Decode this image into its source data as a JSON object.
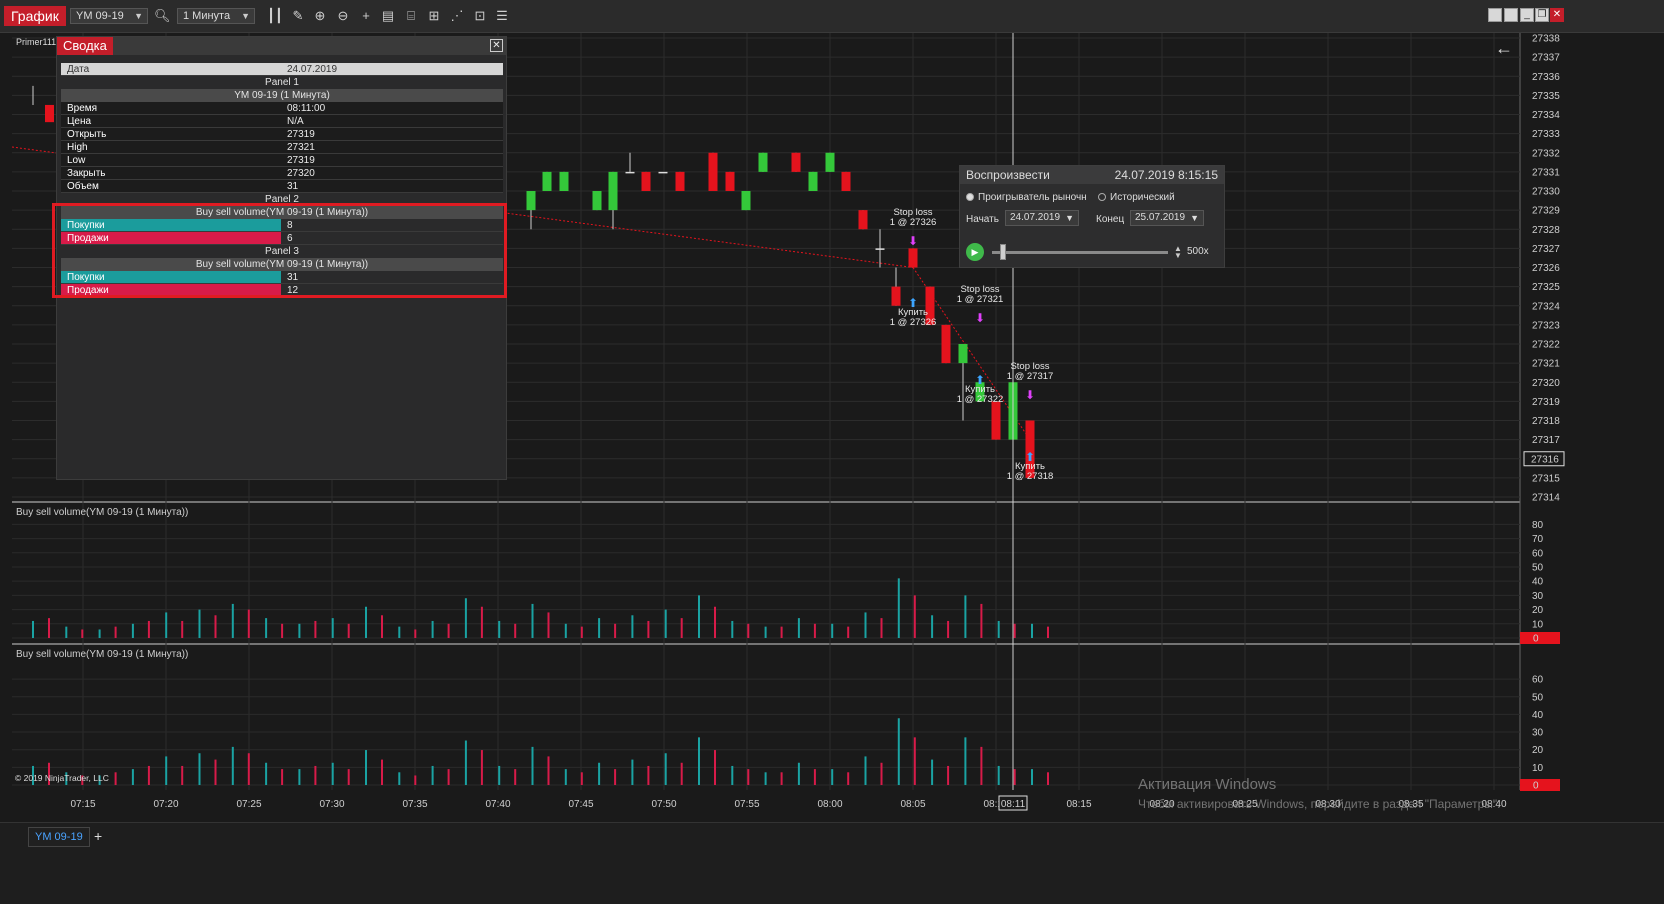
{
  "toolbar": {
    "app_title": "График",
    "instrument": "YM 09-19",
    "interval": "1 Минута"
  },
  "chart": {
    "indicator_label": "Primer111",
    "panel2_title": "Buy sell volume(YM 09-19 (1 Минута))",
    "panel3_title": "Buy sell volume(YM 09-19 (1 Минута))",
    "price_ticks": [
      "27338",
      "27337",
      "27336",
      "27335",
      "27334",
      "27333",
      "27332",
      "27331",
      "27330",
      "27329",
      "27328",
      "27327",
      "27326",
      "27325",
      "27324",
      "27323",
      "27322",
      "27321",
      "27320",
      "27319",
      "27318",
      "27317",
      "27316",
      "27315",
      "27314"
    ],
    "current_price": "27316",
    "panel2_ticks": [
      "80",
      "70",
      "60",
      "50",
      "40",
      "30",
      "20",
      "10",
      "0"
    ],
    "panel3_ticks": [
      "60",
      "50",
      "40",
      "30",
      "20",
      "10",
      "0"
    ],
    "time_ticks": [
      "07:15",
      "07:20",
      "07:25",
      "07:30",
      "07:35",
      "07:40",
      "07:45",
      "07:50",
      "07:55",
      "08:00",
      "08:05",
      "08:10",
      "08:15",
      "08:20",
      "08:25",
      "08:30",
      "08:35",
      "08:40"
    ],
    "crosshair_time": "08:11",
    "copyright": "© 2019 NinjaTrader, LLC",
    "markers": [
      {
        "text1": "Stop loss",
        "text2": "1 @ 27326"
      },
      {
        "text1": "Купить",
        "text2": "1 @ 27326"
      },
      {
        "text1": "Stop loss",
        "text2": "1 @ 27321"
      },
      {
        "text1": "Купить",
        "text2": "1 @ 27322"
      },
      {
        "text1": "Stop loss",
        "text2": "1 @ 27317"
      },
      {
        "text1": "Купить",
        "text2": "1 @ 27318"
      }
    ],
    "colors": {
      "up": "#34c83a",
      "down": "#e5131d",
      "buy": "#1aa3a3",
      "sell": "#d81b49"
    }
  },
  "summary": {
    "title": "Сводка",
    "date_label": "Дата",
    "date_value": "24.07.2019",
    "panel1": "Panel 1",
    "panel1_sub": "YM 09-19 (1 Минута)",
    "rows": [
      {
        "k": "Время",
        "v": "08:11:00"
      },
      {
        "k": "Цена",
        "v": "N/A"
      },
      {
        "k": "Открыть",
        "v": "27319"
      },
      {
        "k": "High",
        "v": "27321"
      },
      {
        "k": "Low",
        "v": "27319"
      },
      {
        "k": "Закрыть",
        "v": "27320"
      },
      {
        "k": "Объем",
        "v": "31"
      }
    ],
    "panel2": "Panel 2",
    "panel2_sub": "Buy sell volume(YM 09-19 (1 Минута))",
    "p2_buy_label": "Покупки",
    "p2_buy_value": "8",
    "p2_sell_label": "Продажи",
    "p2_sell_value": "6",
    "panel3": "Panel 3",
    "panel3_sub": "Buy sell volume(YM 09-19 (1 Минута))",
    "p3_buy_label": "Покупки",
    "p3_buy_value": "31",
    "p3_sell_label": "Продажи",
    "p3_sell_value": "12"
  },
  "playback": {
    "title": "Воспроизвести",
    "datetime": "24.07.2019 8:15:15",
    "radio_market": "Проигрыватель рыночн",
    "radio_hist": "Исторический",
    "start_label": "Начать",
    "start_value": "24.07.2019",
    "end_label": "Конец",
    "end_value": "25.07.2019",
    "speed": "500x"
  },
  "watermark": {
    "line1": "Активация Windows",
    "line2": "Чтобы активировать Windows, перейдите в раздел \"Параметры\"."
  },
  "bottom": {
    "tab": "YM 09-19",
    "add": "+"
  },
  "chart_data": {
    "type": "bar",
    "candles_description": "candlestick price chart with buy/sell volume bars",
    "candles": [
      {
        "t": "07:46",
        "o": 27329,
        "c": 27330,
        "h": 27330,
        "l": 27328
      },
      {
        "t": "07:47",
        "o": 27330,
        "c": 27331,
        "h": 27331,
        "l": 27330
      },
      {
        "t": "07:48",
        "o": 27330,
        "c": 27331,
        "h": 27331,
        "l": 27330
      },
      {
        "t": "07:50",
        "o": 27329,
        "c": 27330,
        "h": 27330,
        "l": 27329
      },
      {
        "t": "07:51",
        "o": 27329,
        "c": 27331,
        "h": 27331,
        "l": 27328
      },
      {
        "t": "07:53",
        "o": 27331,
        "c": 27331,
        "h": 27332,
        "l": 27331
      },
      {
        "t": "07:55",
        "o": 27331,
        "c": 27330,
        "h": 27331,
        "l": 27330
      },
      {
        "t": "07:56",
        "o": 27331,
        "c": 27331,
        "h": 27331,
        "l": 27331
      },
      {
        "t": "07:58",
        "o": 27331,
        "c": 27330,
        "h": 27331,
        "l": 27330
      },
      {
        "t": "07:59",
        "o": 27332,
        "c": 27330,
        "h": 27332,
        "l": 27330
      },
      {
        "t": "08:00",
        "o": 27331,
        "c": 27330,
        "h": 27331,
        "l": 27330
      },
      {
        "t": "08:01",
        "o": 27329,
        "c": 27330,
        "h": 27330,
        "l": 27329
      },
      {
        "t": "08:02",
        "o": 27331,
        "c": 27332,
        "h": 27332,
        "l": 27331
      },
      {
        "t": "08:03",
        "o": 27332,
        "c": 27331,
        "h": 27332,
        "l": 27331
      },
      {
        "t": "08:04",
        "o": 27330,
        "c": 27331,
        "h": 27331,
        "l": 27330
      },
      {
        "t": "08:05",
        "o": 27331,
        "c": 27332,
        "h": 27332,
        "l": 27331
      },
      {
        "t": "08:06",
        "o": 27331,
        "c": 27330,
        "h": 27331,
        "l": 27330
      },
      {
        "t": "08:08",
        "o": 27329,
        "c": 27328,
        "h": 27329,
        "l": 27328
      },
      {
        "t": "08:10",
        "o": 27327,
        "c": 27327,
        "h": 27328,
        "l": 27326
      },
      {
        "t": "08:11",
        "o": 27325,
        "c": 27324,
        "h": 27326,
        "l": 27324
      },
      {
        "t": "08:12",
        "o": 27327,
        "c": 27326,
        "h": 27327,
        "l": 27326
      },
      {
        "t": "08:13",
        "o": 27325,
        "c": 27323,
        "h": 27325,
        "l": 27323
      },
      {
        "t": "08:14",
        "o": 27323,
        "c": 27321,
        "h": 27323,
        "l": 27321
      },
      {
        "t": "08:14b",
        "o": 27321,
        "c": 27322,
        "h": 27322,
        "l": 27318
      },
      {
        "t": "08:15",
        "o": 27319,
        "c": 27320,
        "h": 27320,
        "l": 27319
      },
      {
        "t": "08:16",
        "o": 27319,
        "c": 27317,
        "h": 27319,
        "l": 27317
      },
      {
        "t": "08:16b",
        "o": 27317,
        "c": 27320,
        "h": 27320,
        "l": 27317
      },
      {
        "t": "08:17",
        "o": 27318,
        "c": 27315,
        "h": 27318,
        "l": 27315
      }
    ],
    "volume_panel2_buy": [
      12,
      8,
      6,
      10,
      18,
      20,
      24,
      14,
      10,
      14,
      22,
      8,
      12,
      28,
      12,
      24,
      10,
      14,
      16,
      20,
      30,
      12,
      8,
      14,
      10,
      18,
      42,
      16,
      30,
      12,
      10
    ],
    "volume_panel2_sell": [
      14,
      6,
      8,
      12,
      12,
      16,
      20,
      10,
      12,
      10,
      16,
      6,
      10,
      22,
      10,
      18,
      8,
      10,
      12,
      14,
      22,
      10,
      8,
      10,
      8,
      14,
      30,
      12,
      24,
      10,
      8
    ]
  }
}
